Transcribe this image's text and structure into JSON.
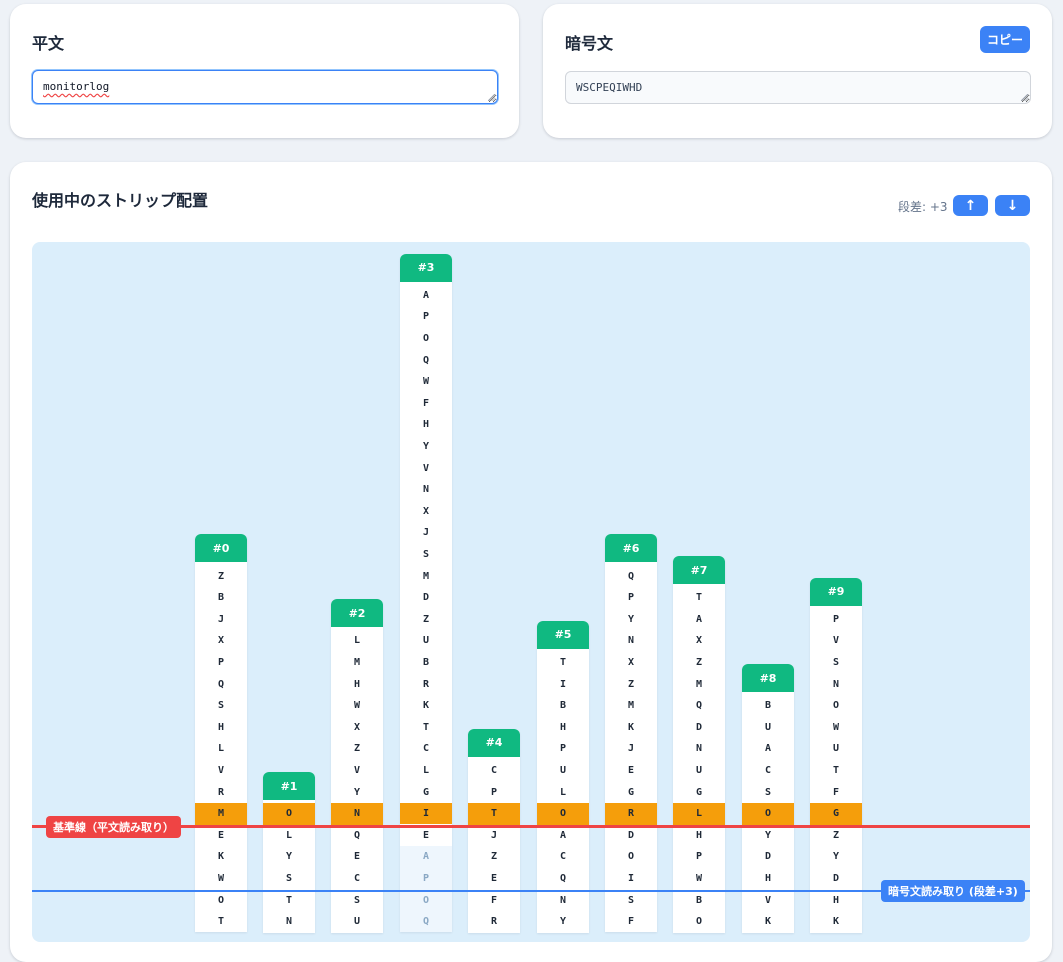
{
  "plaintext_panel": {
    "title": "平文",
    "input_value": "monitorlog"
  },
  "ciphertext_panel": {
    "title": "暗号文",
    "copy_label": "コピー",
    "output_value": "WSCPEQIWHD"
  },
  "strips_panel": {
    "title": "使用中のストリップ配置",
    "offset_label": "段差: +3",
    "up_icon": "arrow-up-icon",
    "down_icon": "arrow-down-icon",
    "up_glyph": "↑",
    "down_glyph": "↓",
    "baseline_label": "基準線（平文読み取り）",
    "cipher_line_label": "暗号文読み取り (段差+3)",
    "colors": {
      "header": "#10b981",
      "highlight": "#f59e0b",
      "baseline": "#ef4444",
      "cipherline": "#3b82f6",
      "area": "#dbeefb"
    },
    "strips": [
      {
        "label": "#0",
        "letters": [
          "Z",
          "B",
          "J",
          "X",
          "P",
          "Q",
          "S",
          "H",
          "L",
          "V",
          "R",
          "M",
          "E",
          "K",
          "W",
          "O",
          "T"
        ],
        "highlight_index": 11,
        "faded_from": null
      },
      {
        "label": "#1",
        "letters": [
          "O",
          "L",
          "Y",
          "S",
          "T",
          "N"
        ],
        "highlight_index": 0,
        "faded_from": null
      },
      {
        "label": "#2",
        "letters": [
          "L",
          "M",
          "H",
          "W",
          "X",
          "Z",
          "V",
          "Y",
          "N",
          "Q",
          "E",
          "C",
          "S",
          "U"
        ],
        "highlight_index": 8,
        "faded_from": null
      },
      {
        "label": "#3",
        "letters": [
          "A",
          "P",
          "O",
          "Q",
          "W",
          "F",
          "H",
          "Y",
          "V",
          "N",
          "X",
          "J",
          "S",
          "M",
          "D",
          "Z",
          "U",
          "B",
          "R",
          "K",
          "T",
          "C",
          "L",
          "G",
          "I",
          "E",
          "A",
          "P",
          "O",
          "Q"
        ],
        "highlight_index": 24,
        "faded_from": 26
      },
      {
        "label": "#4",
        "letters": [
          "C",
          "P",
          "T",
          "J",
          "Z",
          "E",
          "F",
          "R"
        ],
        "highlight_index": 2,
        "faded_from": null
      },
      {
        "label": "#5",
        "letters": [
          "T",
          "I",
          "B",
          "H",
          "P",
          "U",
          "L",
          "O",
          "A",
          "C",
          "Q",
          "N",
          "Y"
        ],
        "highlight_index": 7,
        "faded_from": null
      },
      {
        "label": "#6",
        "letters": [
          "Q",
          "P",
          "Y",
          "N",
          "X",
          "Z",
          "M",
          "K",
          "J",
          "E",
          "G",
          "R",
          "D",
          "O",
          "I",
          "S",
          "F"
        ],
        "highlight_index": 11,
        "faded_from": null
      },
      {
        "label": "#7",
        "letters": [
          "T",
          "A",
          "X",
          "Z",
          "M",
          "Q",
          "D",
          "N",
          "U",
          "G",
          "L",
          "H",
          "P",
          "W",
          "B",
          "O"
        ],
        "highlight_index": 10,
        "faded_from": null
      },
      {
        "label": "#8",
        "letters": [
          "B",
          "U",
          "A",
          "C",
          "S",
          "O",
          "Y",
          "D",
          "H",
          "V",
          "K"
        ],
        "highlight_index": 5,
        "faded_from": null
      },
      {
        "label": "#9",
        "letters": [
          "P",
          "V",
          "S",
          "N",
          "O",
          "W",
          "U",
          "T",
          "F",
          "G",
          "Z",
          "Y",
          "D",
          "H",
          "K"
        ],
        "highlight_index": 9,
        "faded_from": null
      }
    ]
  }
}
